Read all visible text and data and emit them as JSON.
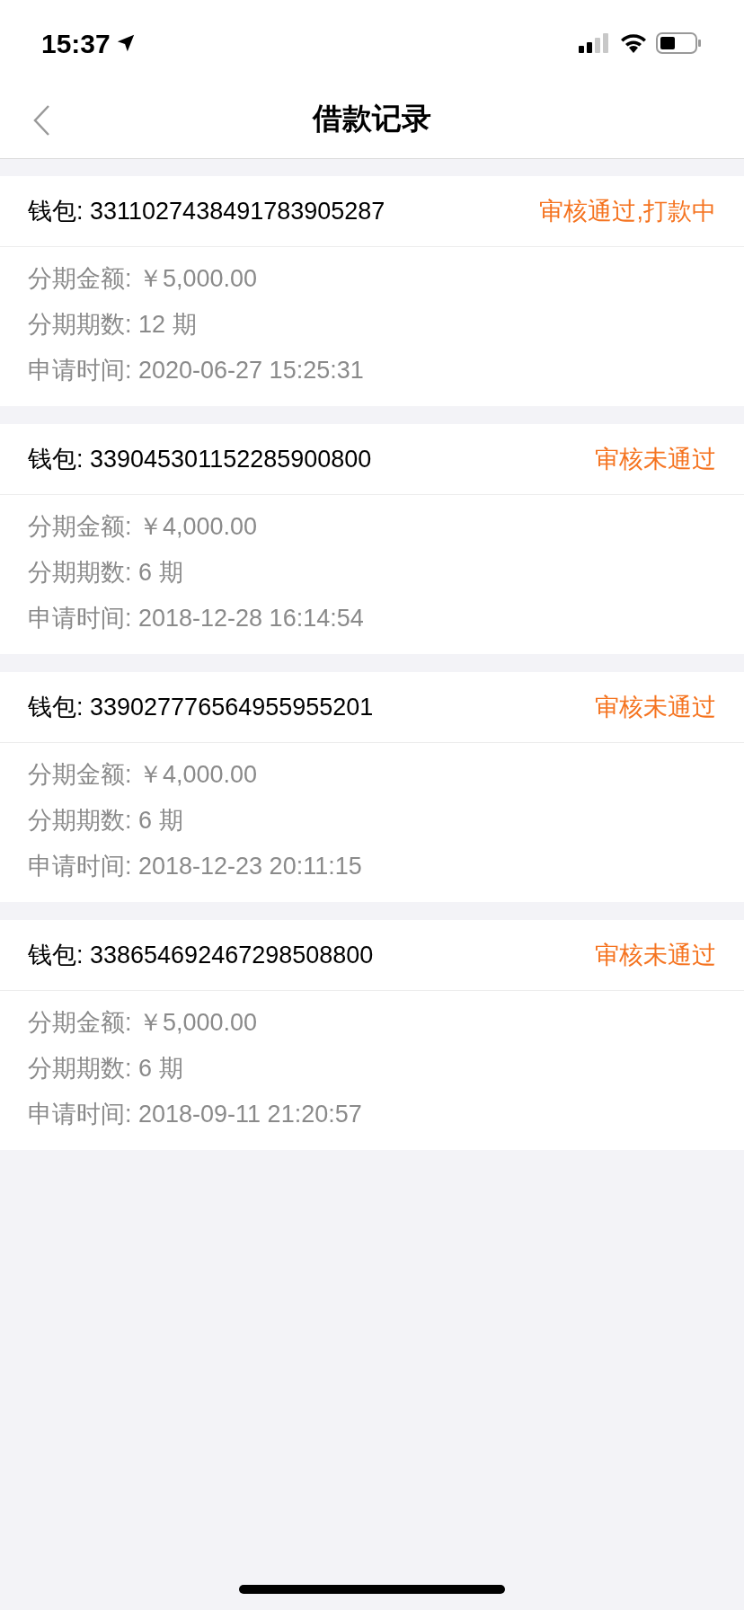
{
  "status_bar": {
    "time": "15:37"
  },
  "nav": {
    "title": "借款记录"
  },
  "records": [
    {
      "wallet": "钱包: 3311027438491783905287",
      "status": "审核通过,打款中",
      "details": [
        "分期金额: ￥5,000.00",
        "分期期数: 12 期",
        "申请时间: 2020-06-27 15:25:31"
      ]
    },
    {
      "wallet": "钱包: 339045301152285900800",
      "status": "审核未通过",
      "details": [
        "分期金额: ￥4,000.00",
        "分期期数: 6 期",
        "申请时间: 2018-12-28 16:14:54"
      ]
    },
    {
      "wallet": "钱包: 339027776564955955201",
      "status": "审核未通过",
      "details": [
        "分期金额: ￥4,000.00",
        "分期期数: 6 期",
        "申请时间: 2018-12-23 20:11:15"
      ]
    },
    {
      "wallet": "钱包: 338654692467298508800",
      "status": "审核未通过",
      "details": [
        "分期金额: ￥5,000.00",
        "分期期数: 6 期",
        "申请时间: 2018-09-11 21:20:57"
      ]
    }
  ]
}
